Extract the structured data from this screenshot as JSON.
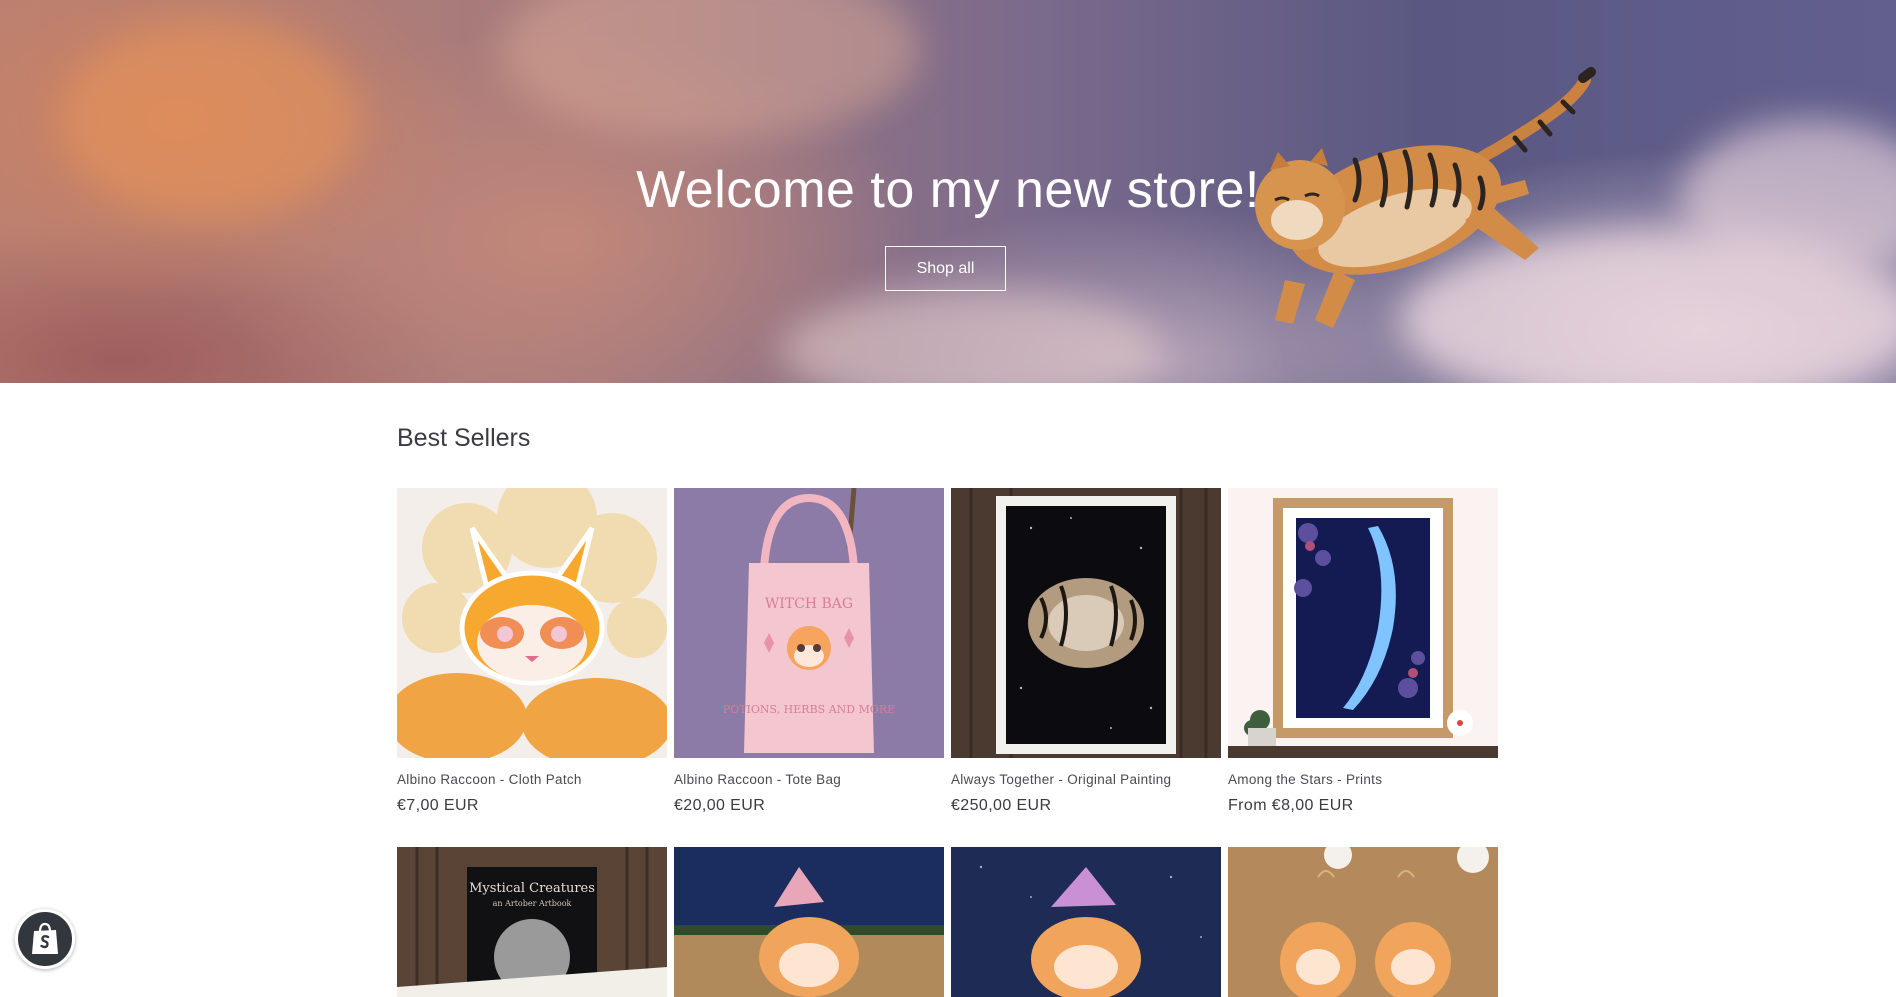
{
  "hero": {
    "title": "Welcome to my new store!",
    "button_label": "Shop all"
  },
  "best_sellers": {
    "heading": "Best Sellers",
    "products": [
      {
        "name": "Albino Raccoon - Cloth Patch",
        "price": "€7,00 EUR"
      },
      {
        "name": "Albino Raccoon - Tote Bag",
        "price": "€20,00 EUR"
      },
      {
        "name": "Always Together - Original Painting",
        "price": "€250,00 EUR"
      },
      {
        "name": "Among the Stars - Prints",
        "price": "From €8,00 EUR"
      }
    ],
    "row2_images": [
      {
        "title_text": "Mystical Creatures",
        "subtitle_text": "an Artober Artbook"
      }
    ]
  },
  "icons": {
    "shopify_badge": "shopify-bag-icon"
  }
}
